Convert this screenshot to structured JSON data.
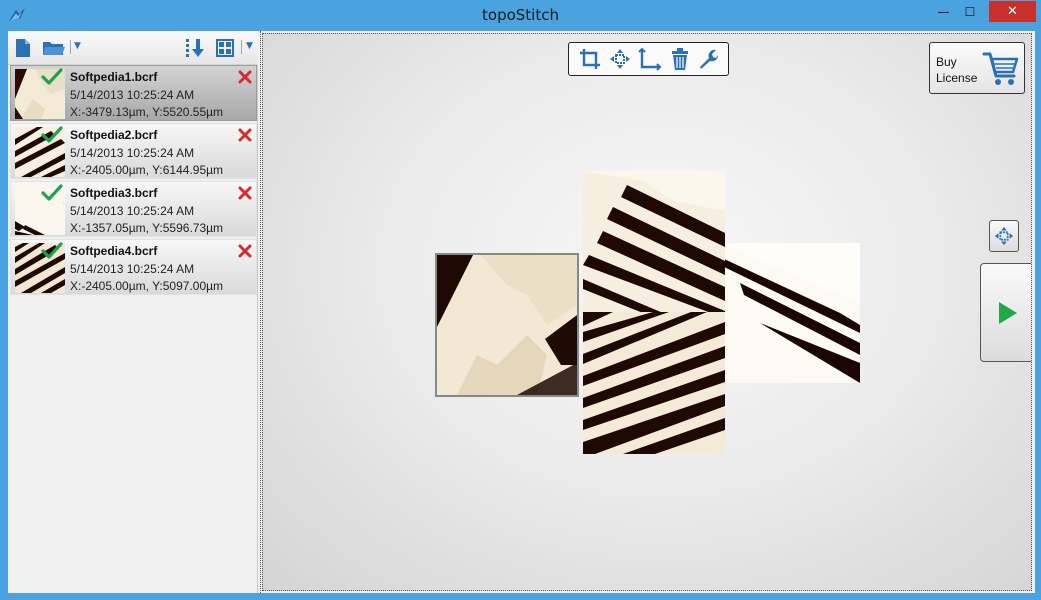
{
  "window": {
    "title": "topoStitch",
    "minimize_glyph": "—",
    "maximize_glyph": "☐",
    "close_glyph": "✕"
  },
  "toolbar": {
    "icons": [
      "new-file-icon",
      "open-folder-icon",
      "sort-down-icon",
      "grid-view-icon"
    ],
    "dropdown_glyph": "▼"
  },
  "files": [
    {
      "name": "Softpedia1.bcrf",
      "date": "5/14/2013 10:25:24 AM",
      "position": "X:-3479.13µm, Y:5520.55µm",
      "selected": true
    },
    {
      "name": "Softpedia2.bcrf",
      "date": "5/14/2013 10:25:24 AM",
      "position": "X:-2405.00µm, Y:6144.95µm",
      "selected": false
    },
    {
      "name": "Softpedia3.bcrf",
      "date": "5/14/2013 10:25:24 AM",
      "position": "X:-1357.05µm, Y:5596.73µm",
      "selected": false
    },
    {
      "name": "Softpedia4.bcrf",
      "date": "5/14/2013 10:25:24 AM",
      "position": "X:-2405.00µm, Y:5097.00µm",
      "selected": false
    }
  ],
  "canvas_tools": [
    "crop-icon",
    "move-icon",
    "measure-icon",
    "delete-icon",
    "wrench-icon"
  ],
  "buy": {
    "label_line1": "Buy",
    "label_line2": "License",
    "icon": "cart-icon"
  },
  "side_controls": [
    "pan-icon",
    "play-icon"
  ],
  "colors": {
    "accent": "#4aa3df",
    "close": "#c7302b",
    "check": "#1fa34a",
    "remove": "#d42b2b",
    "play": "#22a846",
    "icon_blue": "#2a70b5"
  }
}
